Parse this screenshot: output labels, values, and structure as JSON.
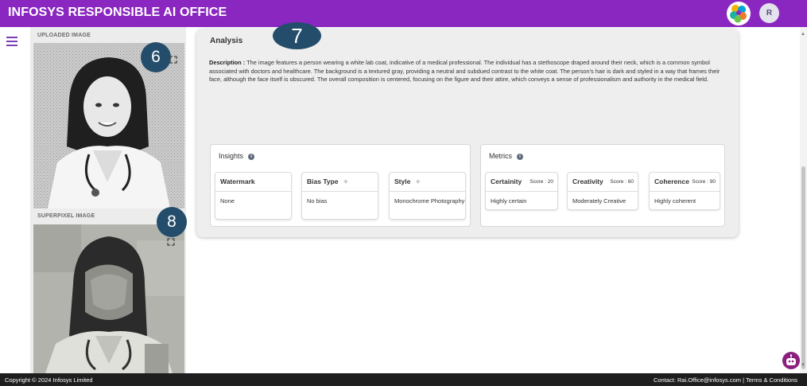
{
  "header": {
    "app_title": "INFOSYS RESPONSIBLE AI OFFICE",
    "avatar_initial": "R"
  },
  "left_panel": {
    "uploaded_label": "UPLOADED IMAGE",
    "superpixel_label": "SUPERPIXEL IMAGE",
    "badge_uploaded": "6",
    "badge_superpixel": "8"
  },
  "analysis": {
    "badge": "7",
    "title": "Analysis",
    "description_label": "Description :",
    "description": "The image features a person wearing a white lab coat, indicative of a medical professional. The individual has a stethoscope draped around their neck, which is a common symbol associated with doctors and healthcare. The background is a textured gray, providing a neutral and subdued contrast to the white coat. The person's hair is dark and styled in a way that frames their face, although the face itself is obscured. The overall composition is centered, focusing on the figure and their attire, which conveys a sense of professionalism and authority in the medical field."
  },
  "insights": {
    "title": "Insights",
    "tiles": [
      {
        "head": "Watermark",
        "value": "None"
      },
      {
        "head": "Bias Type",
        "value": "No bias"
      },
      {
        "head": "Style",
        "value": "Monochrome Photography"
      }
    ]
  },
  "metrics": {
    "title": "Metrics",
    "tiles": [
      {
        "head": "Certainity",
        "score": "Score : 20",
        "value": "Highly certain"
      },
      {
        "head": "Creativity",
        "score": "Score : 60",
        "value": "Moderately Creative"
      },
      {
        "head": "Coherence",
        "score": "Score : 90",
        "value": "Highly coherent"
      }
    ]
  },
  "footer": {
    "copyright": "Copyright © 2024 Infosys Limited",
    "contact": "Contact: Rai.Office@infosys.com | Terms & Conditions"
  },
  "colors": {
    "brand": "#8b27c1",
    "badge": "#234d6b",
    "footer": "#1e1e1e",
    "bot": "#8b1f7d"
  },
  "icons": [
    "menu-icon",
    "info-icon",
    "magic-wand-icon",
    "expand-icon",
    "chatbot-icon"
  ]
}
